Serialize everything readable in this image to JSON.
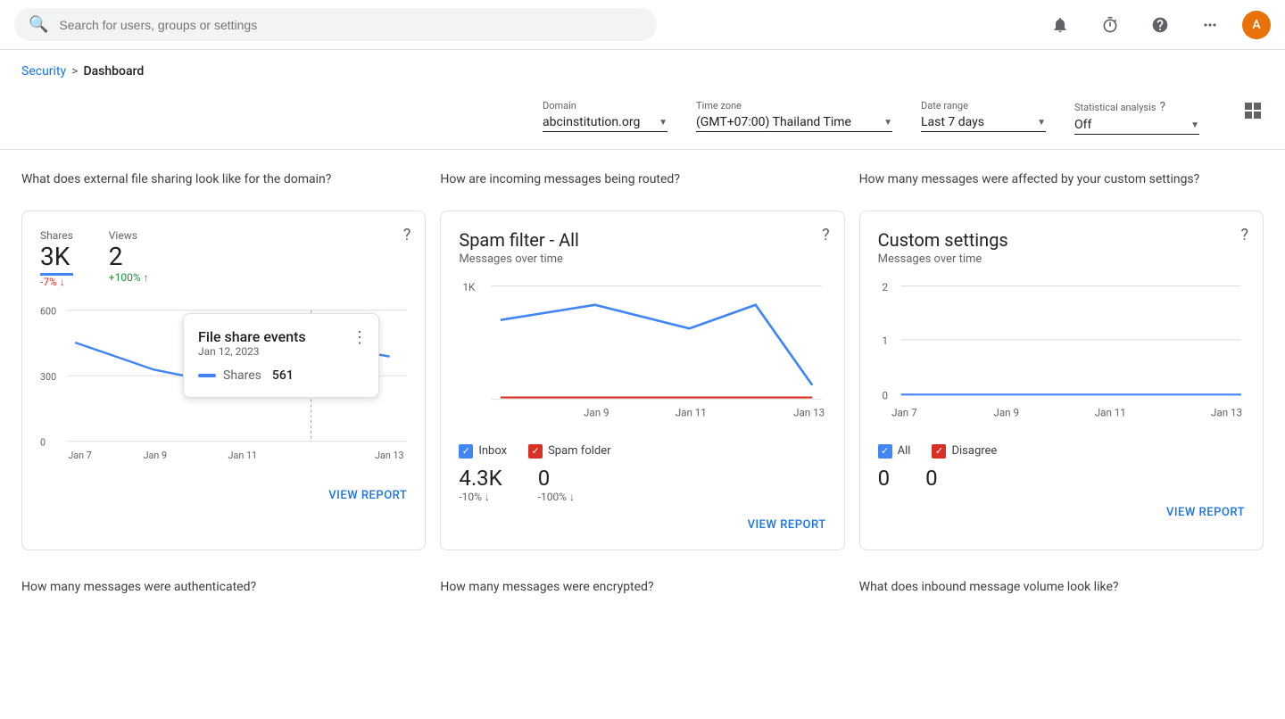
{
  "topbar": {
    "search_placeholder": "Search for users, groups or settings",
    "avatar_letter": "A"
  },
  "breadcrumb": {
    "security": "Security",
    "separator": ">",
    "current": "Dashboard"
  },
  "filters": {
    "domain_label": "Domain",
    "domain_value": "abcinstitution.org",
    "timezone_label": "Time zone",
    "timezone_value": "(GMT+07:00) Thailand Time",
    "daterange_label": "Date range",
    "daterange_value": "Last 7 days",
    "statanalysis_label": "Statistical analysis",
    "statanalysis_value": "Off"
  },
  "card1": {
    "section_question": "What does external file sharing look like for the domain?",
    "shares_label": "Shares",
    "shares_value": "3K",
    "shares_change": "-7% ↓",
    "views_label": "Views",
    "views_value": "2",
    "views_change": "+100% ↑",
    "x_labels": [
      "Jan 7",
      "Jan 9",
      "Jan 11",
      "Jan 13"
    ],
    "y_labels": [
      "600",
      "300",
      "0"
    ],
    "tooltip_title": "File share events",
    "tooltip_date": "Jan 12, 2023",
    "tooltip_shares_label": "Shares",
    "tooltip_shares_value": "561",
    "view_report": "VIEW REPORT"
  },
  "card2": {
    "section_question": "How are incoming messages being routed?",
    "title": "Spam filter - All",
    "subtitle": "Messages over time",
    "y_labels": [
      "1K"
    ],
    "x_labels": [
      "Jan 9",
      "Jan 11",
      "Jan 13"
    ],
    "inbox_label": "Inbox",
    "spamfolder_label": "Spam folder",
    "inbox_value": "4.3K",
    "inbox_change": "-10% ↓",
    "spamfolder_value": "0",
    "spamfolder_change": "-100% ↓",
    "view_report": "VIEW REPORT"
  },
  "card3": {
    "section_question": "How many messages were affected by your custom settings?",
    "title": "Custom settings",
    "subtitle": "Messages over time",
    "y_labels": [
      "2",
      "1",
      "0"
    ],
    "x_labels": [
      "Jan 7",
      "Jan 9",
      "Jan 11",
      "Jan 13"
    ],
    "all_label": "All",
    "disagree_label": "Disagree",
    "all_value": "0",
    "disagree_value": "0",
    "view_report": "VIEW REPORT"
  },
  "bottom_labels": {
    "label1": "How many messages were authenticated?",
    "label2": "How many messages were encrypted?",
    "label3": "What does inbound message volume look like?"
  }
}
